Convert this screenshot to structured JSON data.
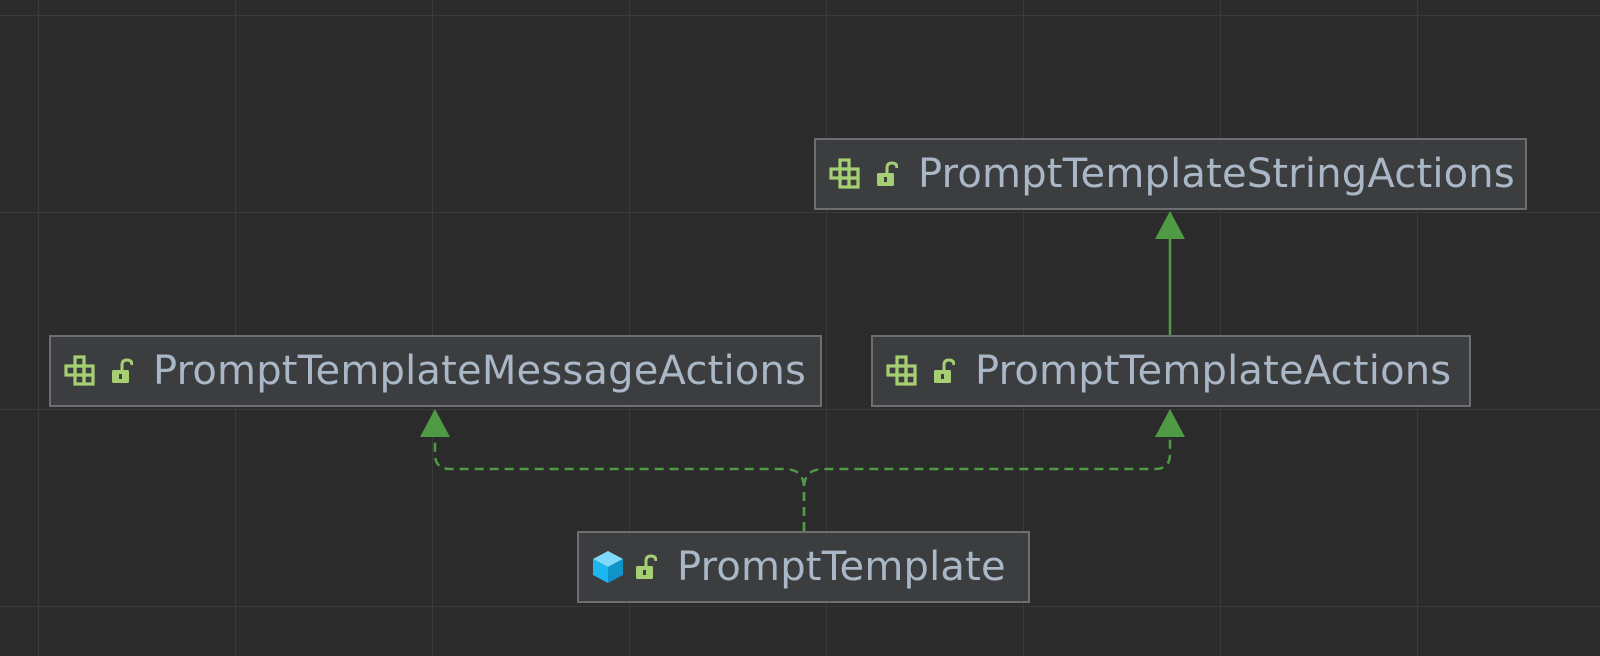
{
  "diagram": {
    "nodes": [
      {
        "id": "strings",
        "label": "PromptTemplateStringActions",
        "kind": "interface",
        "icon": "interface-icon",
        "visibility_icon": "unlocked-icon"
      },
      {
        "id": "message",
        "label": "PromptTemplateMessageActions",
        "kind": "interface",
        "icon": "interface-icon",
        "visibility_icon": "unlocked-icon"
      },
      {
        "id": "actions",
        "label": "PromptTemplateActions",
        "kind": "interface",
        "icon": "interface-icon",
        "visibility_icon": "unlocked-icon"
      },
      {
        "id": "prompt",
        "label": "PromptTemplate",
        "kind": "class",
        "icon": "class-cube-icon",
        "visibility_icon": "unlocked-icon"
      }
    ],
    "edges": [
      {
        "from": "actions",
        "to": "strings",
        "relation": "extends",
        "style": "solid"
      },
      {
        "from": "prompt",
        "to": "message",
        "relation": "implements",
        "style": "dashed"
      },
      {
        "from": "prompt",
        "to": "actions",
        "relation": "implements",
        "style": "dashed"
      }
    ],
    "colors": {
      "background": "#2b2b2c",
      "grid": "#3a3a3b",
      "node_fill": "#3c3d3f",
      "node_border": "#6c6e72",
      "label": "#a9b7c6",
      "edge": "#4f9a45",
      "interface_icon": "#a6cf73",
      "class_icon": "#1cb6f2"
    }
  }
}
